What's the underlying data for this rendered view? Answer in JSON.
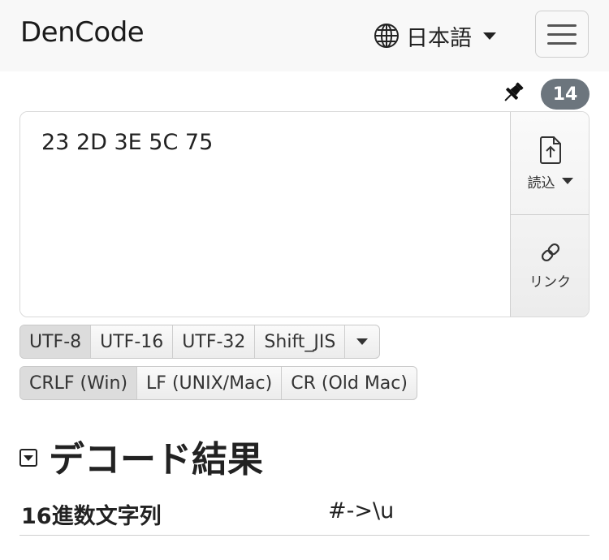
{
  "navbar": {
    "brand": "DenCode",
    "language": "日本語",
    "globe_icon": "globe-icon",
    "menu_icon": "hamburger-icon"
  },
  "toolbar": {
    "pin_icon": "pin-icon",
    "char_count": "14"
  },
  "editor": {
    "value": "23 2D 3E 5C 75",
    "load_label": "読込",
    "link_label": "リンク"
  },
  "encodings": {
    "options": [
      "UTF-8",
      "UTF-16",
      "UTF-32",
      "Shift_JIS"
    ],
    "selected": "UTF-8"
  },
  "line_breaks": {
    "options": [
      "CRLF (Win)",
      "LF (UNIX/Mac)",
      "CR (Old Mac)"
    ],
    "selected": "CRLF (Win)"
  },
  "section": {
    "title": "デコード結果"
  },
  "result": {
    "label": "16進数文字列",
    "value": "#->\\u"
  }
}
